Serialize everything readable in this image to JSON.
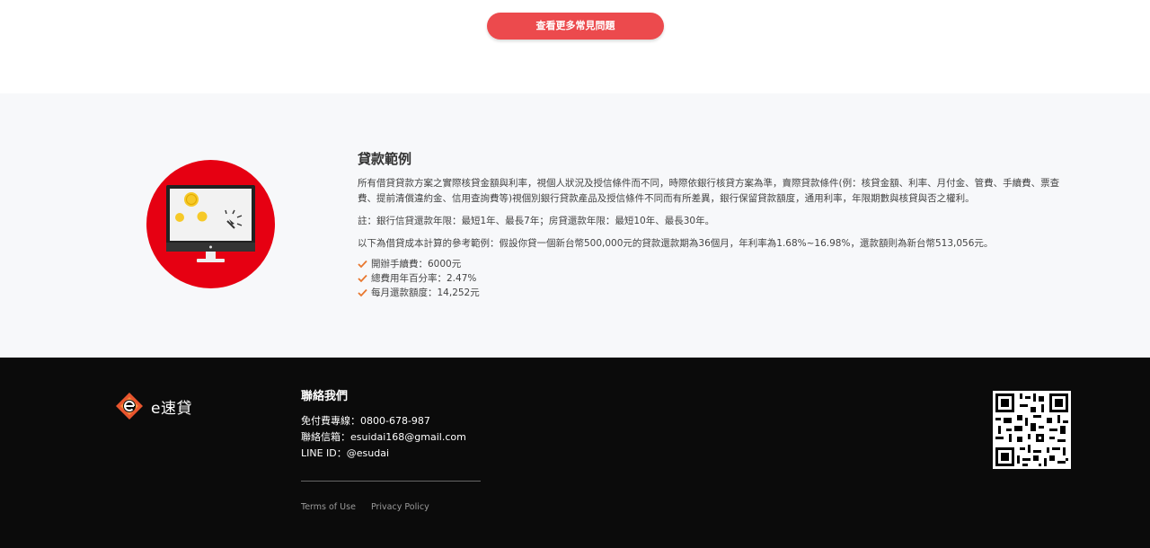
{
  "top": {
    "more_faq_button": "查看更多常見問題"
  },
  "example": {
    "title": "貸款範例",
    "paragraph_1": "所有借貸貸款方案之實際核貸金額與利率，視個人狀況及授信條件而不同，時際依銀行核貸方案為準，賣際貸款條件(例：核貸金額、利率、月付金、管費、手續費、票查費、提前清償違約金、信用查詢費等)視個別銀行貸款產品及授信條件不同而有所差異，銀行保留貸款額度，通用利率，年限期數與核貸與否之權利。",
    "paragraph_2": "註：銀行信貸還款年限：最短1年、最長7年；房貸還款年限：最短10年、最長30年。",
    "paragraph_3": "以下為借貸成本計算的參考範例：假設你貸一個新台幣500,000元的貸款還款期為36個月，年利率為1.68%~16.98%，還款額則為新台幣513,056元。",
    "checks": [
      "開辦手續費：6000元",
      "總費用年百分率：2.47%",
      "每月還款額度：14,252元"
    ],
    "illustration_icon": "monitor-with-coins-icon",
    "accent_color": "#e60012",
    "check_color": "#e8772e"
  },
  "footer": {
    "logo_text": "e速貸",
    "logo_icon": "esudai-logo-icon",
    "contact_title": "聯絡我們",
    "phone": "免付費專線：0800-678-987",
    "email": "聯絡信箱：esuidai168@gmail.com",
    "line": "LINE ID：@esudai",
    "terms": "Terms of Use",
    "privacy": "Privacy Policy",
    "qr_icon": "qr-code-icon"
  }
}
